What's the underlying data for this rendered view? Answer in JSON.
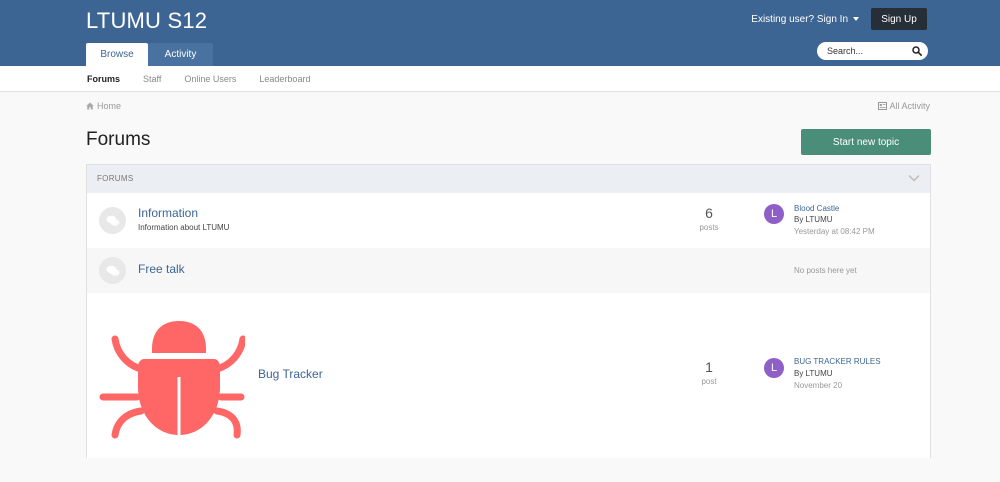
{
  "header": {
    "site_title": "LTUMU S12",
    "signin_label": "Existing user? Sign In",
    "signup_label": "Sign Up",
    "tabs": [
      {
        "label": "Browse",
        "active": true
      },
      {
        "label": "Activity",
        "active": false
      }
    ],
    "search_placeholder": "Search...",
    "bg_color": "#3d6594"
  },
  "subnav": {
    "items": [
      {
        "label": "Forums",
        "active": true
      },
      {
        "label": "Staff",
        "active": false
      },
      {
        "label": "Online Users",
        "active": false
      },
      {
        "label": "Leaderboard",
        "active": false
      }
    ]
  },
  "breadcrumb": {
    "home": "Home",
    "all_activity": "All Activity"
  },
  "page": {
    "title": "Forums",
    "start_topic_label": "Start new topic",
    "accent_color": "#4a8e7a"
  },
  "forum_section": {
    "header": "FORUMS",
    "forums": [
      {
        "name": "Information",
        "description": "Information about LTUMU",
        "post_count": "6",
        "post_label": "posts",
        "last_post": {
          "title": "Blood Castle",
          "by": "By LTUMU",
          "time": "Yesterday at 08:42 PM",
          "avatar_letter": "L"
        }
      },
      {
        "name": "Free talk",
        "no_posts": "No posts here yet"
      },
      {
        "name": "Bug Tracker",
        "post_count": "1",
        "post_label": "post",
        "last_post": {
          "title": "BUG TRACKER RULES",
          "by": "By LTUMU",
          "time": "November 20",
          "avatar_letter": "L"
        }
      }
    ]
  }
}
